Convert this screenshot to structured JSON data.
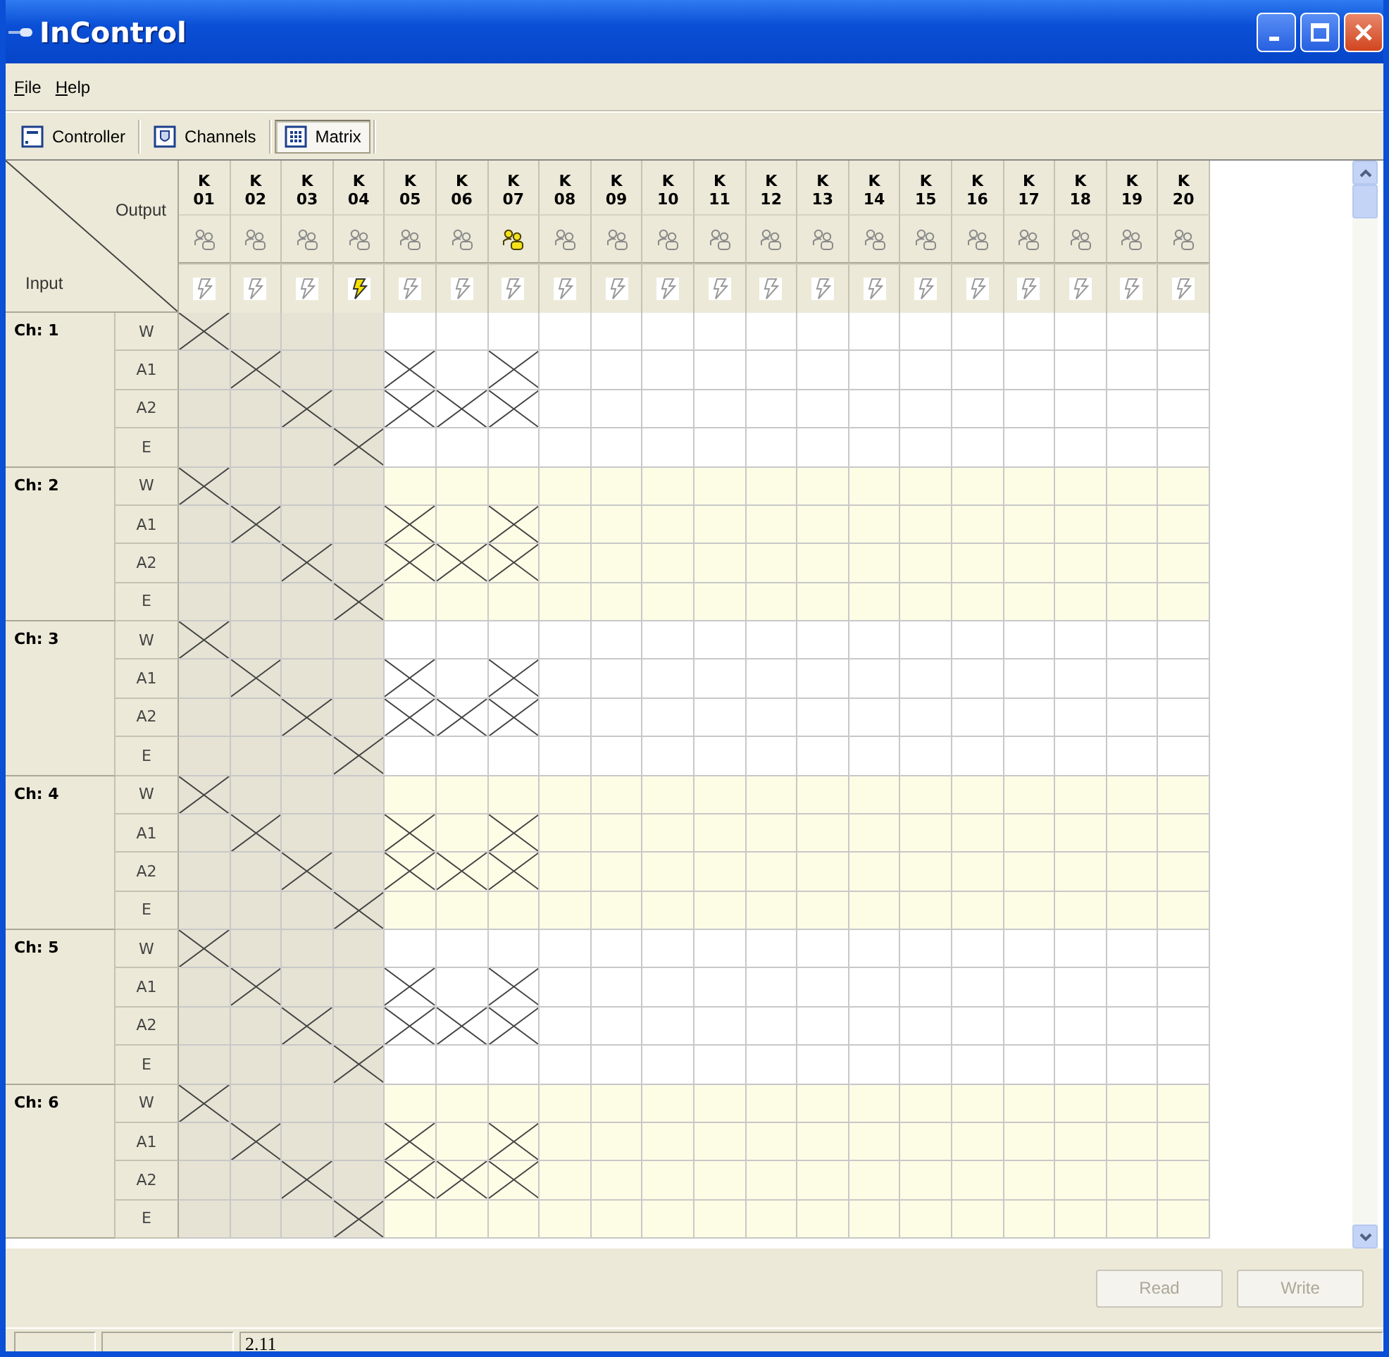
{
  "window": {
    "title": "InControl"
  },
  "menu": [
    {
      "label": "File"
    },
    {
      "label": "Help"
    }
  ],
  "toolbar": [
    {
      "kind": "controller",
      "label": "Controller",
      "selected": false
    },
    {
      "kind": "channels",
      "label": "Channels",
      "selected": false
    },
    {
      "kind": "matrix",
      "label": "Matrix",
      "selected": true
    }
  ],
  "matrix": {
    "output_label": "Output",
    "input_label": "Input",
    "columns": [
      {
        "prefix": "K",
        "number": "01",
        "dimmed": true,
        "group_active": false,
        "power_active": false
      },
      {
        "prefix": "K",
        "number": "02",
        "dimmed": true,
        "group_active": false,
        "power_active": false
      },
      {
        "prefix": "K",
        "number": "03",
        "dimmed": true,
        "group_active": false,
        "power_active": false
      },
      {
        "prefix": "K",
        "number": "04",
        "dimmed": true,
        "group_active": false,
        "power_active": true
      },
      {
        "prefix": "K",
        "number": "05",
        "dimmed": false,
        "group_active": false,
        "power_active": false
      },
      {
        "prefix": "K",
        "number": "06",
        "dimmed": false,
        "group_active": false,
        "power_active": false
      },
      {
        "prefix": "K",
        "number": "07",
        "dimmed": false,
        "group_active": true,
        "power_active": false
      },
      {
        "prefix": "K",
        "number": "08",
        "dimmed": false,
        "group_active": false,
        "power_active": false
      },
      {
        "prefix": "K",
        "number": "09",
        "dimmed": false,
        "group_active": false,
        "power_active": false
      },
      {
        "prefix": "K",
        "number": "10",
        "dimmed": false,
        "group_active": false,
        "power_active": false
      },
      {
        "prefix": "K",
        "number": "11",
        "dimmed": false,
        "group_active": false,
        "power_active": false
      },
      {
        "prefix": "K",
        "number": "12",
        "dimmed": false,
        "group_active": false,
        "power_active": false
      },
      {
        "prefix": "K",
        "number": "13",
        "dimmed": false,
        "group_active": false,
        "power_active": false
      },
      {
        "prefix": "K",
        "number": "14",
        "dimmed": false,
        "group_active": false,
        "power_active": false
      },
      {
        "prefix": "K",
        "number": "15",
        "dimmed": false,
        "group_active": false,
        "power_active": false
      },
      {
        "prefix": "K",
        "number": "16",
        "dimmed": false,
        "group_active": false,
        "power_active": false
      },
      {
        "prefix": "K",
        "number": "17",
        "dimmed": false,
        "group_active": false,
        "power_active": false
      },
      {
        "prefix": "K",
        "number": "18",
        "dimmed": false,
        "group_active": false,
        "power_active": false
      },
      {
        "prefix": "K",
        "number": "19",
        "dimmed": false,
        "group_active": false,
        "power_active": false
      },
      {
        "prefix": "K",
        "number": "20",
        "dimmed": false,
        "group_active": false,
        "power_active": false
      }
    ],
    "channels": [
      {
        "name": "Ch: 1",
        "tinted": false,
        "rows": [
          {
            "label": "W",
            "connected": [
              true,
              false,
              false,
              false,
              false,
              false,
              false,
              false,
              false,
              false,
              false,
              false,
              false,
              false,
              false,
              false,
              false,
              false,
              false,
              false
            ]
          },
          {
            "label": "A1",
            "connected": [
              false,
              true,
              false,
              false,
              true,
              false,
              true,
              false,
              false,
              false,
              false,
              false,
              false,
              false,
              false,
              false,
              false,
              false,
              false,
              false
            ]
          },
          {
            "label": "A2",
            "connected": [
              false,
              false,
              true,
              false,
              true,
              true,
              true,
              false,
              false,
              false,
              false,
              false,
              false,
              false,
              false,
              false,
              false,
              false,
              false,
              false
            ]
          },
          {
            "label": "E",
            "connected": [
              false,
              false,
              false,
              true,
              false,
              false,
              false,
              false,
              false,
              false,
              false,
              false,
              false,
              false,
              false,
              false,
              false,
              false,
              false,
              false
            ]
          }
        ]
      },
      {
        "name": "Ch: 2",
        "tinted": true,
        "rows": [
          {
            "label": "W",
            "connected": [
              true,
              false,
              false,
              false,
              false,
              false,
              false,
              false,
              false,
              false,
              false,
              false,
              false,
              false,
              false,
              false,
              false,
              false,
              false,
              false
            ]
          },
          {
            "label": "A1",
            "connected": [
              false,
              true,
              false,
              false,
              true,
              false,
              true,
              false,
              false,
              false,
              false,
              false,
              false,
              false,
              false,
              false,
              false,
              false,
              false,
              false
            ]
          },
          {
            "label": "A2",
            "connected": [
              false,
              false,
              true,
              false,
              true,
              true,
              true,
              false,
              false,
              false,
              false,
              false,
              false,
              false,
              false,
              false,
              false,
              false,
              false,
              false
            ]
          },
          {
            "label": "E",
            "connected": [
              false,
              false,
              false,
              true,
              false,
              false,
              false,
              false,
              false,
              false,
              false,
              false,
              false,
              false,
              false,
              false,
              false,
              false,
              false,
              false
            ]
          }
        ]
      },
      {
        "name": "Ch: 3",
        "tinted": false,
        "rows": [
          {
            "label": "W",
            "connected": [
              true,
              false,
              false,
              false,
              false,
              false,
              false,
              false,
              false,
              false,
              false,
              false,
              false,
              false,
              false,
              false,
              false,
              false,
              false,
              false
            ]
          },
          {
            "label": "A1",
            "connected": [
              false,
              true,
              false,
              false,
              true,
              false,
              true,
              false,
              false,
              false,
              false,
              false,
              false,
              false,
              false,
              false,
              false,
              false,
              false,
              false
            ]
          },
          {
            "label": "A2",
            "connected": [
              false,
              false,
              true,
              false,
              true,
              true,
              true,
              false,
              false,
              false,
              false,
              false,
              false,
              false,
              false,
              false,
              false,
              false,
              false,
              false
            ]
          },
          {
            "label": "E",
            "connected": [
              false,
              false,
              false,
              true,
              false,
              false,
              false,
              false,
              false,
              false,
              false,
              false,
              false,
              false,
              false,
              false,
              false,
              false,
              false,
              false
            ]
          }
        ]
      },
      {
        "name": "Ch: 4",
        "tinted": true,
        "rows": [
          {
            "label": "W",
            "connected": [
              true,
              false,
              false,
              false,
              false,
              false,
              false,
              false,
              false,
              false,
              false,
              false,
              false,
              false,
              false,
              false,
              false,
              false,
              false,
              false
            ]
          },
          {
            "label": "A1",
            "connected": [
              false,
              true,
              false,
              false,
              true,
              false,
              true,
              false,
              false,
              false,
              false,
              false,
              false,
              false,
              false,
              false,
              false,
              false,
              false,
              false
            ]
          },
          {
            "label": "A2",
            "connected": [
              false,
              false,
              true,
              false,
              true,
              true,
              true,
              false,
              false,
              false,
              false,
              false,
              false,
              false,
              false,
              false,
              false,
              false,
              false,
              false
            ]
          },
          {
            "label": "E",
            "connected": [
              false,
              false,
              false,
              true,
              false,
              false,
              false,
              false,
              false,
              false,
              false,
              false,
              false,
              false,
              false,
              false,
              false,
              false,
              false,
              false
            ]
          }
        ]
      },
      {
        "name": "Ch: 5",
        "tinted": false,
        "rows": [
          {
            "label": "W",
            "connected": [
              true,
              false,
              false,
              false,
              false,
              false,
              false,
              false,
              false,
              false,
              false,
              false,
              false,
              false,
              false,
              false,
              false,
              false,
              false,
              false
            ]
          },
          {
            "label": "A1",
            "connected": [
              false,
              true,
              false,
              false,
              true,
              false,
              true,
              false,
              false,
              false,
              false,
              false,
              false,
              false,
              false,
              false,
              false,
              false,
              false,
              false
            ]
          },
          {
            "label": "A2",
            "connected": [
              false,
              false,
              true,
              false,
              true,
              true,
              true,
              false,
              false,
              false,
              false,
              false,
              false,
              false,
              false,
              false,
              false,
              false,
              false,
              false
            ]
          },
          {
            "label": "E",
            "connected": [
              false,
              false,
              false,
              true,
              false,
              false,
              false,
              false,
              false,
              false,
              false,
              false,
              false,
              false,
              false,
              false,
              false,
              false,
              false,
              false
            ]
          }
        ]
      },
      {
        "name": "Ch: 6",
        "tinted": true,
        "rows": [
          {
            "label": "W",
            "connected": [
              true,
              false,
              false,
              false,
              false,
              false,
              false,
              false,
              false,
              false,
              false,
              false,
              false,
              false,
              false,
              false,
              false,
              false,
              false,
              false
            ]
          },
          {
            "label": "A1",
            "connected": [
              false,
              true,
              false,
              false,
              true,
              false,
              true,
              false,
              false,
              false,
              false,
              false,
              false,
              false,
              false,
              false,
              false,
              false,
              false,
              false
            ]
          },
          {
            "label": "A2",
            "connected": [
              false,
              false,
              true,
              false,
              true,
              true,
              true,
              false,
              false,
              false,
              false,
              false,
              false,
              false,
              false,
              false,
              false,
              false,
              false,
              false
            ]
          },
          {
            "label": "E",
            "connected": [
              false,
              false,
              false,
              true,
              false,
              false,
              false,
              false,
              false,
              false,
              false,
              false,
              false,
              false,
              false,
              false,
              false,
              false,
              false,
              false
            ]
          }
        ]
      }
    ]
  },
  "buttons": [
    {
      "label": "Read",
      "disabled": true
    },
    {
      "label": "Write",
      "disabled": true
    }
  ],
  "status_bar": {
    "version": "2.11"
  }
}
